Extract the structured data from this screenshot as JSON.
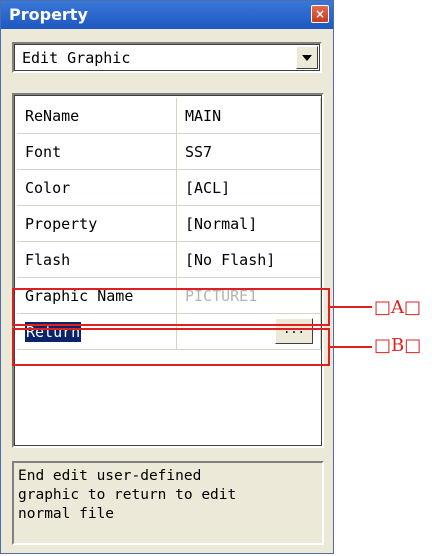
{
  "window": {
    "title": "Property",
    "close_glyph": "×"
  },
  "dropdown": {
    "selected": "Edit Graphic"
  },
  "properties": [
    {
      "key": "ReName",
      "value": "MAIN"
    },
    {
      "key": "Font",
      "value": "SS7"
    },
    {
      "key": "Color",
      "value": "[ACL]"
    },
    {
      "key": "Property",
      "value": "[Normal]"
    },
    {
      "key": "Flash",
      "value": "[No Flash]"
    },
    {
      "key": "Graphic Name",
      "value": "PICTURE1"
    },
    {
      "key": "Return",
      "value": ""
    }
  ],
  "return_button_label": "...",
  "description": [
    "End edit user-defined",
    "graphic to return to edit",
    "normal file"
  ],
  "callouts": {
    "a": "□A□",
    "b": "□B□"
  },
  "colors": {
    "title_bar": "#1e58c2",
    "callout": "#e02020",
    "selection": "#0a246a"
  }
}
